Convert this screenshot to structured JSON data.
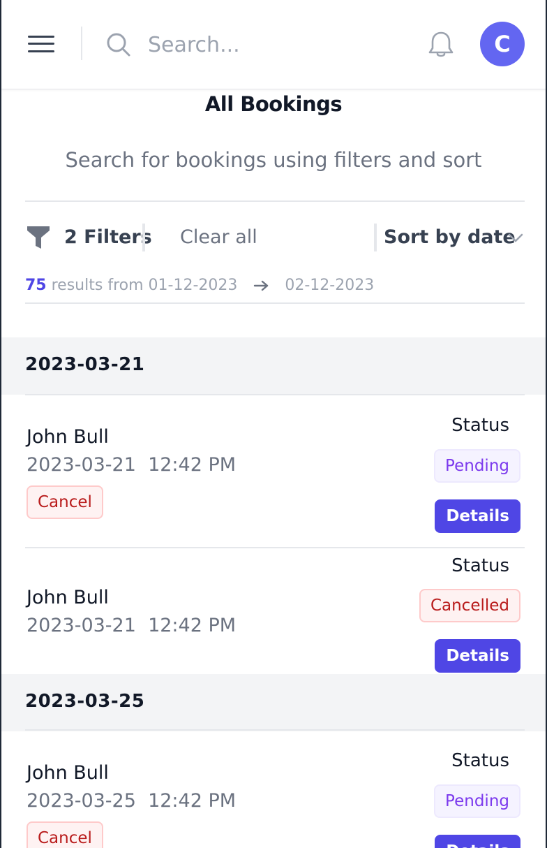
{
  "header": {
    "search_placeholder": "Search...",
    "avatar_initial": "C"
  },
  "page": {
    "title": "All Bookings",
    "subtitle": "Search for bookings using filters and sort"
  },
  "filters": {
    "filters_label": "2 Filters",
    "clear_all": "Clear all",
    "sort_label": "Sort by date"
  },
  "results": {
    "count": "75",
    "text": "results from 01-12-2023",
    "end_date": "02-12-2023"
  },
  "groups": [
    {
      "date": "2023-03-21",
      "bookings": [
        {
          "name": "John Bull",
          "datetime": "2023-03-21  12:42 PM",
          "status_label": "Status",
          "status": "Pending",
          "cancel_label": "Cancel",
          "details_label": "Details"
        },
        {
          "name": "John Bull",
          "datetime": "2023-03-21  12:42 PM",
          "status_label": "Status",
          "status": "Cancelled",
          "details_label": "Details"
        }
      ]
    },
    {
      "date": "2023-03-25",
      "bookings": [
        {
          "name": "John Bull",
          "datetime": "2023-03-25  12:42 PM",
          "status_label": "Status",
          "status": "Pending",
          "cancel_label": "Cancel",
          "details_label": "Details"
        }
      ]
    }
  ],
  "colors": {
    "accent": "#4f46e5",
    "avatar": "#6366f1",
    "pending": "#7c3aed",
    "cancelled": "#b91c1c"
  },
  "icons": [
    "menu-icon",
    "search-icon",
    "bell-icon",
    "funnel-icon",
    "chevron-down-icon",
    "arrow-right-icon"
  ]
}
